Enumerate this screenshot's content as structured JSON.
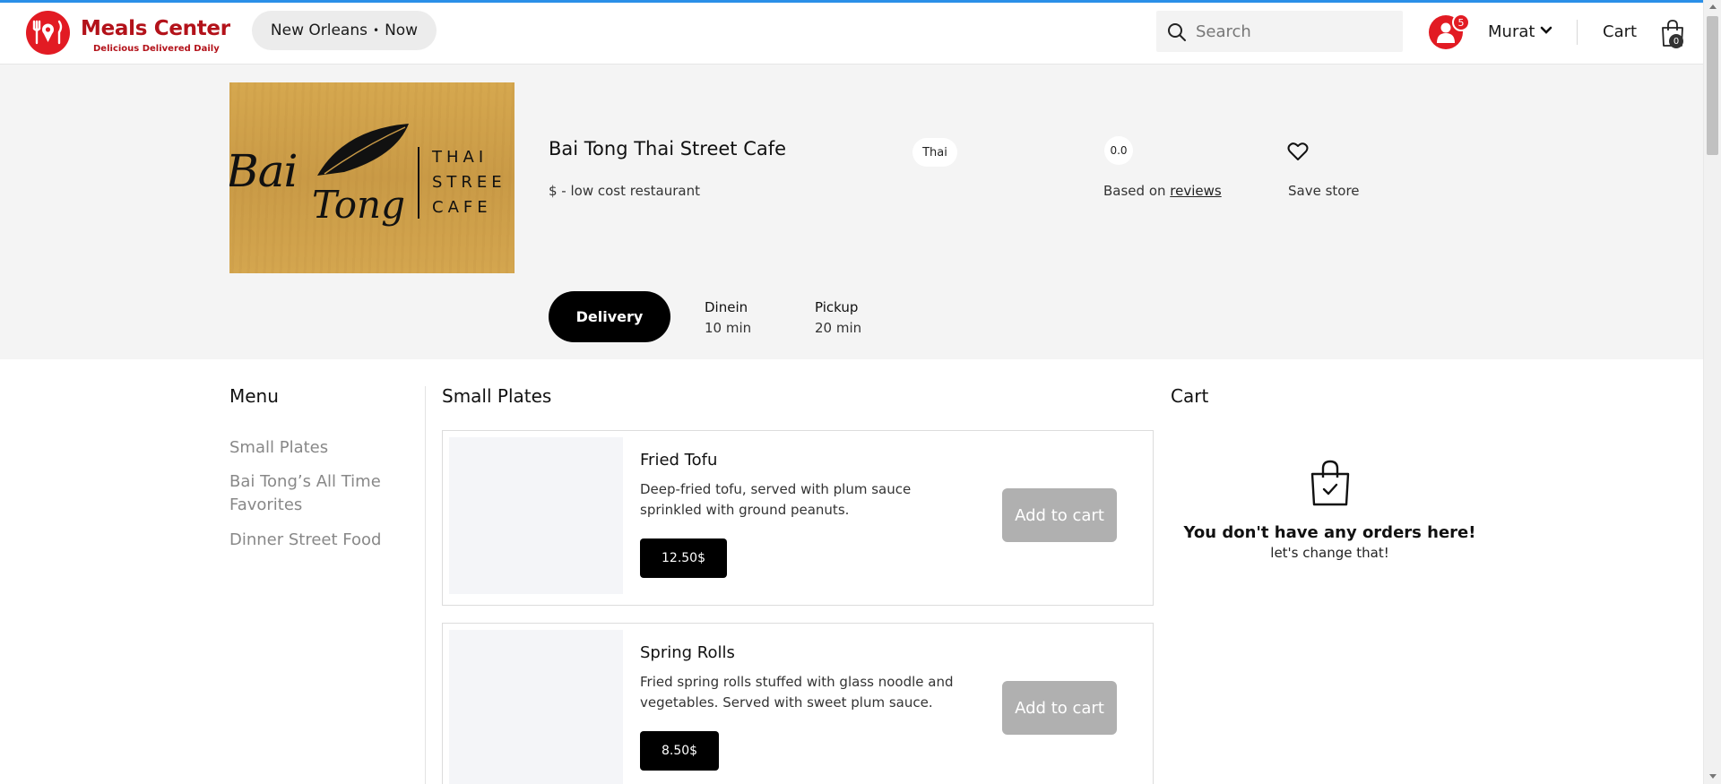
{
  "header": {
    "brand_name": "Meals Center",
    "brand_tagline": "Delicious Delivered Daily",
    "location": "New Orleans",
    "location_separator": "•",
    "time": "Now",
    "search_placeholder": "Search",
    "notification_count": "5",
    "user_name": "Murat",
    "cart_label": "Cart",
    "cart_count": "0",
    "accent_color": "#e21b23"
  },
  "store": {
    "logo_text_script_1": "Bai",
    "logo_text_script_2": "Tong",
    "logo_text_right": [
      "THAI",
      "STREE",
      "CAFE"
    ],
    "name": "Bai Tong Thai Street Cafe",
    "price_level": "$ - low cost restaurant",
    "cuisine": "Thai",
    "rating": "0.0",
    "rating_prefix": "Based on",
    "rating_link": "reviews",
    "save_label": "Save store",
    "modes": [
      {
        "label": "Delivery",
        "active": true
      },
      {
        "label": "Dinein",
        "time": "10 min"
      },
      {
        "label": "Pickup",
        "time": "20 min"
      }
    ]
  },
  "menu": {
    "heading": "Menu",
    "items": [
      "Small Plates",
      "Bai Tong’s All Time Favorites",
      "Dinner Street Food"
    ]
  },
  "section": {
    "title": "Small Plates",
    "products": [
      {
        "name": "Fried Tofu",
        "description": "Deep-fried tofu, served with plum sauce sprinkled with ground peanuts.",
        "price": "12.50$",
        "add_label": "Add to cart"
      },
      {
        "name": "Spring Rolls",
        "description": "Fried spring rolls stuffed with glass noodle and vegetables. Served with sweet plum sauce.",
        "price": "8.50$",
        "add_label": "Add to cart"
      }
    ]
  },
  "cart": {
    "heading": "Cart",
    "empty_title": "You don't have any orders here!",
    "empty_subtitle": "let's change that!"
  }
}
